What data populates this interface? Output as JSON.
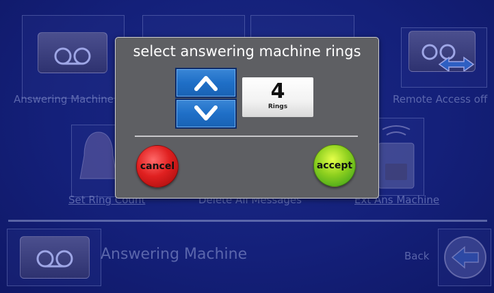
{
  "background": {
    "tiles": [
      {
        "label": "Answering Machine"
      },
      {
        "label": "Remote Access off"
      },
      {
        "label": "Set Ring Count"
      },
      {
        "label": "Delete All Messages"
      },
      {
        "label": "Ext Ans Machine"
      }
    ],
    "footer": {
      "title": "Answering Machine",
      "back_label": "Back"
    }
  },
  "dialog": {
    "title": "select answering machine rings",
    "rings_value": "4",
    "rings_label": "Rings",
    "cancel_label": "cancel",
    "accept_label": "accept"
  },
  "colors": {
    "background": "#14207a",
    "dialog": "#5e5f63",
    "arrow_button": "#1f6fc7",
    "cancel": "#e02020",
    "accept": "#8ed01f"
  },
  "icons": {
    "answering_machine": "tape-icon",
    "remote_access": "tape-arrow-icon",
    "ring_count": "bell-icon",
    "delete_messages": "trash-icon",
    "ext_machine": "device-icon",
    "back": "back-arrow-icon",
    "up": "chevron-up-icon",
    "down": "chevron-down-icon"
  }
}
